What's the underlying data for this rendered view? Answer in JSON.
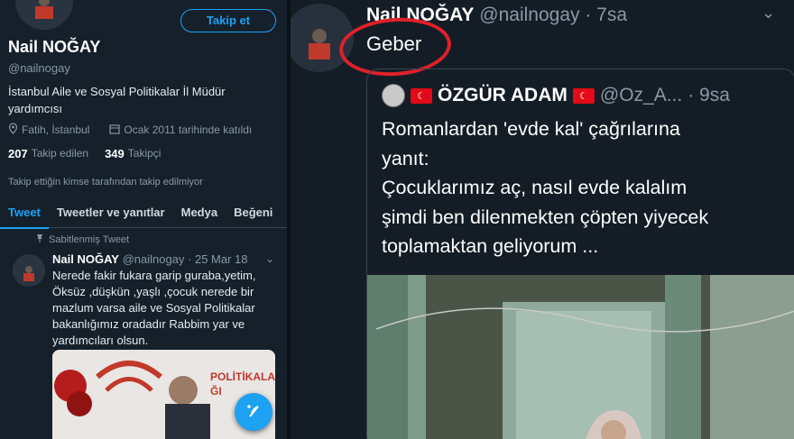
{
  "profile": {
    "follow_label": "Takip et",
    "name": "Nail NOĞAY",
    "handle": "@nailnogay",
    "bio": "İstanbul Aile ve Sosyal Politikalar İl Müdür yardımcısı",
    "location": "Fatih, İstanbul",
    "joined": "Ocak 2011 tarihinde katıldı",
    "following_count": "207",
    "following_label": "Takip edilen",
    "followers_count": "349",
    "followers_label": "Takipçi",
    "not_followed_note": "Takip ettiğin kimse tarafından takip edilmiyor"
  },
  "tabs": [
    {
      "label": "Tweet"
    },
    {
      "label": "Tweetler ve yanıtlar"
    },
    {
      "label": "Medya"
    },
    {
      "label": "Beğeni"
    }
  ],
  "pinned_tweet": {
    "pinned_label": "Sabitlenmiş Tweet",
    "name": "Nail NOĞAY",
    "handle": "@nailnogay",
    "date": "· 25 Mar 18",
    "text": "Nerede fakir fukara garip guraba,yetim, Öksüz ,düşkün ,yaşlı ,çocuk nerede bir mazlum varsa aile ve Sosyal Politikalar bakanlığımız oradadır Rabbim yar ve yardımcıları olsun.",
    "image_text_1": "POLİTİKALAR",
    "image_text_2": "ĞI"
  },
  "reply_tweet": {
    "name": "Nail NOĞAY",
    "handle": "@nailnogay",
    "time": "· 7sa",
    "text": "Geber"
  },
  "quoted_tweet": {
    "name": "ÖZGÜR ADAM",
    "handle": "@Oz_A...",
    "time": "· 9sa",
    "line_1": "Romanlardan 'evde kal' çağrılarına",
    "line_2": "yanıt:",
    "line_3": "Çocuklarımız aç, nasıl evde kalalım",
    "line_4": "şimdi ben dilenmekten çöpten yiyecek",
    "line_5": "toplamaktan geliyorum ..."
  },
  "colors": {
    "accent": "#1da1f2",
    "background": "#15202b",
    "annotation": "#e0202a"
  }
}
